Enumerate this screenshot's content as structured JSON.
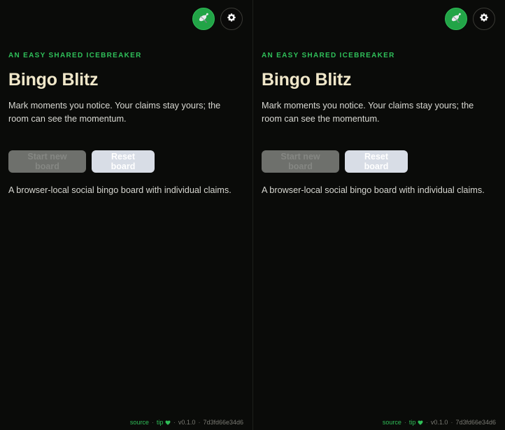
{
  "app": {
    "left_pane": {
      "eyebrow": "AN EASY SHARED ICEBREAKER",
      "title": "Bingo Blitz",
      "description": "Mark moments you notice. Your claims stay yours; the room can see the momentum.",
      "buttons": {
        "primary_label": "Start new board",
        "reset_label": "Reset board"
      },
      "subtext": "A browser-local social bingo board with individual claims.",
      "footer": {
        "source_label": "source",
        "tip_label": "tip",
        "separator": "·",
        "version": "v0.1.0",
        "commit": "7d3fd66e34d6"
      },
      "icons": {
        "sync": "satellite-dish-icon",
        "settings": "gear-icon",
        "tip": "heart-icon"
      }
    },
    "right_pane": {
      "eyebrow": "AN EASY SHARED ICEBREAKER",
      "title": "Bingo Blitz",
      "description": "Mark moments you notice. Your claims stay yours; the room can see the momentum.",
      "buttons": {
        "primary_label": "Start new board",
        "reset_label": "Reset board"
      },
      "subtext": "A browser-local social bingo board with individual claims.",
      "footer": {
        "source_label": "source",
        "tip_label": "tip",
        "separator": "·",
        "version": "v0.1.0",
        "commit": "7d3fd66e34d6"
      },
      "icons": {
        "sync": "satellite-dish-icon",
        "settings": "gear-icon",
        "tip": "heart-icon"
      }
    },
    "colors": {
      "accent_green": "#2fbe57",
      "title_cream": "#f0e7c9",
      "background": "#0a0b09"
    }
  }
}
